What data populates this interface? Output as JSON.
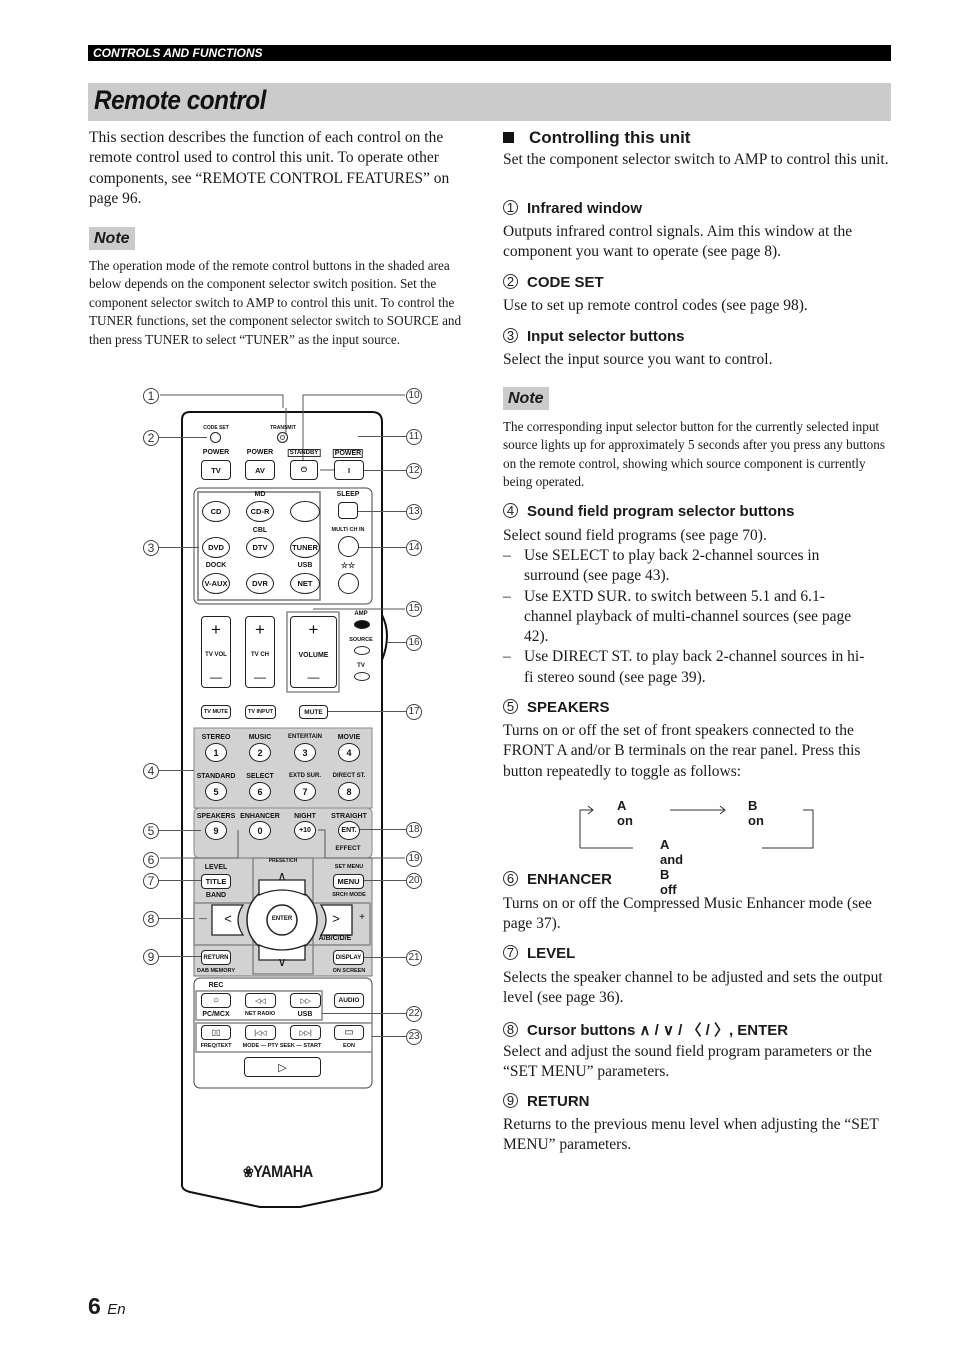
{
  "header": {
    "section": "CONTROLS AND FUNCTIONS",
    "title": "Remote control"
  },
  "left": {
    "intro": "This section describes the function of each control on the remote control used to control this unit. To operate other components, see “REMOTE CONTROL FEATURES” on page 96.",
    "note_label": "Note",
    "note_text": "The operation mode of the remote control buttons in the shaded area below depends on the component selector switch position. Set the component selector switch to AMP to control this unit. To control the TUNER functions, set the component selector switch to SOURCE and then press TUNER to select “TUNER” as the input source."
  },
  "right": {
    "section_heading": "Controlling this unit",
    "section_intro": "Set the component selector switch to AMP to control this unit.",
    "items": [
      {
        "num": "1",
        "title": "Infrared window",
        "text": "Outputs infrared control signals. Aim this window at the component you want to operate (see page 8)."
      },
      {
        "num": "2",
        "title": "CODE SET",
        "text": "Use to set up remote control codes (see page 98)."
      },
      {
        "num": "3",
        "title": "Input selector buttons",
        "text": "Select the input source you want to control."
      },
      {
        "num": "4",
        "title": "Sound field program selector buttons",
        "text": "Select sound field programs (see page 70).",
        "bullets": [
          "Use SELECT to play back 2-channel sources in surround (see page 43).",
          "Use EXTD SUR. to switch between 5.1 and 6.1-channel playback of multi-channel sources (see page 42).",
          "Use DIRECT ST. to play back 2-channel sources in hi-fi stereo sound (see page 39)."
        ]
      },
      {
        "num": "5",
        "title": "SPEAKERS",
        "text": "Turns on or off the set of front speakers connected to the FRONT A and/or B terminals on the rear panel. Press this button repeatedly to toggle as follows:"
      },
      {
        "num": "6",
        "title": "ENHANCER",
        "text": "Turns on or off the Compressed Music Enhancer mode (see page 37)."
      },
      {
        "num": "7",
        "title": "LEVEL",
        "text": "Selects the speaker channel to be adjusted and sets the output level (see page 36)."
      },
      {
        "num": "8",
        "title": "Cursor buttons ∧ / ∨ / 〈 / 〉, ENTER",
        "text": "Select and adjust the sound field program parameters or the “SET MENU” parameters."
      },
      {
        "num": "9",
        "title": "RETURN",
        "text": "Returns to the previous menu level when adjusting the “SET MENU” parameters."
      }
    ],
    "note_label": "Note",
    "note_text": "The corresponding input selector button for the currently selected input source lights up for approximately 5 seconds after you press any buttons on the remote control, showing which source component is currently being operated.",
    "speaker_cycle": {
      "a_on": "A on",
      "b_on": "B on",
      "off": "A and B off"
    }
  },
  "remote": {
    "code_set": "CODE SET",
    "transmit": "TRANSMIT",
    "power": "POWER",
    "tv": "TV",
    "av": "AV",
    "standby": "STANDBY",
    "standby_glyph": "⏻",
    "power_on_glyph": "I",
    "md": "MD",
    "cd": "CD",
    "cdr": "CD-R",
    "sleep": "SLEEP",
    "cbl": "CBL",
    "dvd": "DVD",
    "dtv": "DTV",
    "tuner": "TUNER",
    "multi_ch_in": "MULTI CH IN",
    "dock": "DOCK",
    "usb": "USB",
    "stars": "☆☆",
    "vaux": "V-AUX",
    "dvr": "DVR",
    "net": "NET",
    "amp": "AMP",
    "source": "SOURCE",
    "tv_sw": "TV",
    "plus": "+",
    "minus": "—",
    "tv_vol": "TV VOL",
    "tv_ch": "TV CH",
    "volume": "VOLUME",
    "tv_mute": "TV MUTE",
    "tv_input": "TV INPUT",
    "mute": "MUTE",
    "programs": [
      {
        "label": "STEREO",
        "key": "1"
      },
      {
        "label": "MUSIC",
        "key": "2"
      },
      {
        "label": "ENTERTAIN",
        "key": "3"
      },
      {
        "label": "MOVIE",
        "key": "4"
      },
      {
        "label": "STANDARD",
        "key": "5"
      },
      {
        "label": "SELECT",
        "key": "6"
      },
      {
        "label": "EXTD SUR.",
        "key": "7"
      },
      {
        "label": "DIRECT ST.",
        "key": "8"
      },
      {
        "label": "SPEAKERS",
        "key": "9"
      },
      {
        "label": "ENHANCER",
        "key": "0"
      },
      {
        "label": "NIGHT",
        "key": "+10"
      },
      {
        "label": "STRAIGHT",
        "key": "ENT."
      }
    ],
    "effect": "EFFECT",
    "preset_ch": "PRESET/CH",
    "level": "LEVEL",
    "title": "TITLE",
    "band": "BAND",
    "set_menu": "SET MENU",
    "menu": "MENU",
    "srch_mode": "SRCH MODE",
    "enter": "ENTER",
    "abcde": "A/B/C/D/E",
    "up": "∧",
    "down": "∨",
    "left": "<",
    "right": ">",
    "return": "RETURN",
    "dab_memory": "DAB MEMORY",
    "display": "DISPLAY",
    "on_screen": "ON SCREEN",
    "rec": "REC",
    "rec_glyph": "○",
    "rew_glyph": "◁◁",
    "ff_glyph": "▷▷",
    "audio": "AUDIO",
    "pc_mcx": "PC/MCX",
    "net_radio": "NET RADIO",
    "usb2": "USB",
    "pause_glyph": "▯▯",
    "prev_glyph": "|◁◁",
    "next_glyph": "▷▷|",
    "stop_glyph": "▭",
    "freq_text": "FREQ/TEXT",
    "mode_pty": "MODE — PTY SEEK — START",
    "eon": "EON",
    "play_glyph": "▷",
    "brand": "YAMAHA",
    "brand_glyph": "❀",
    "callouts_left": [
      "1",
      "2",
      "3",
      "4",
      "5",
      "6",
      "7",
      "8",
      "9"
    ],
    "callouts_right": [
      "10",
      "11",
      "12",
      "13",
      "14",
      "15",
      "16",
      "17",
      "18",
      "19",
      "20",
      "21",
      "22",
      "23"
    ]
  },
  "footer": {
    "page": "6",
    "lang": "En"
  }
}
